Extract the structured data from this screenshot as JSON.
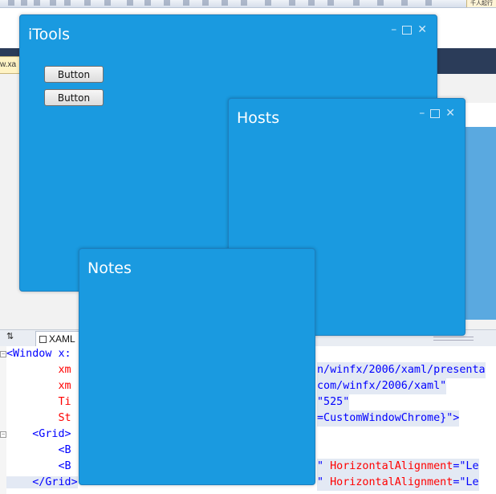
{
  "toolbar": {
    "right_label": "千人起行"
  },
  "document": {
    "tab_fragment": "w.xa"
  },
  "split": {
    "arrows": "⇅",
    "xaml_tab_label": "XAML"
  },
  "code": [
    "<Window x:",
    "        xm",
    "        xm",
    "        Ti",
    "        St",
    "    <Grid>",
    "        <B",
    "        <B",
    "    </Grid>"
  ],
  "code_tail": {
    "line1": "n/winfx/2006/xaml/presenta",
    "line2": "com/winfx/2006/xaml\"",
    "line3": "\"525\"",
    "line4": "=CustomWindowChrome}\">",
    "line6_value": "\"",
    "line6_attr": "HorizontalAlignment",
    "line6_eq": "=\"Le",
    "line7_value": "\"",
    "line7_attr": "HorizontalAlignment",
    "line7_eq": "=\"Le"
  },
  "windows": {
    "itools": {
      "title": "iTools",
      "button1": "Button",
      "button2": "Button"
    },
    "hosts": {
      "title": "Hosts"
    },
    "notes": {
      "title": "Notes"
    }
  },
  "caption": {
    "minimize": "–",
    "close": "✕"
  },
  "colors": {
    "window_bg": "#1a9ae0",
    "title_text": "#ffffff"
  }
}
